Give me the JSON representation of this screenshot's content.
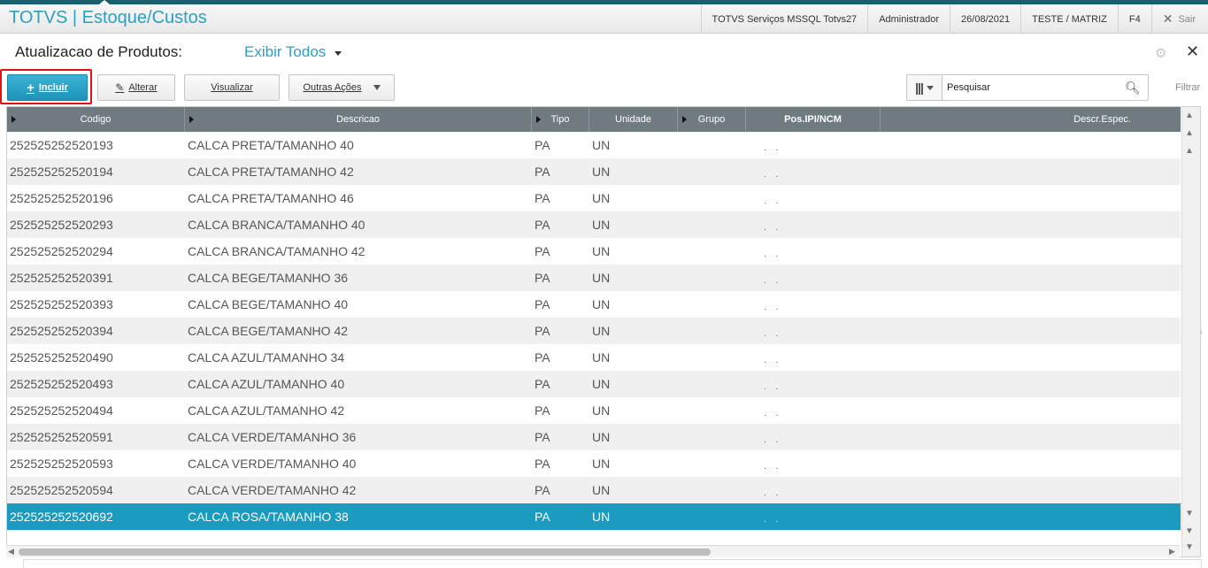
{
  "header": {
    "app_title": "TOTVS | Estoque/Custos",
    "server": "TOTVS Serviços MSSQL Totvs27",
    "user": "Administrador",
    "date": "26/08/2021",
    "company": "TESTE / MATRIZ",
    "hotkey": "F4",
    "exit_label": "Sair"
  },
  "page": {
    "title": "Atualizacao de Produtos:",
    "view_filter": "Exibir Todos"
  },
  "toolbar": {
    "incluir": "Incluir",
    "alterar": "Alterar",
    "visualizar": "Visualizar",
    "outras_acoes": "Outras Ações",
    "search_placeholder": "Pesquisar",
    "filtrar": "Filtrar"
  },
  "table": {
    "columns": [
      "Codigo",
      "Descricao",
      "Tipo",
      "Unidade",
      "Grupo",
      "Pos.IPI/NCM",
      "Descr.Espec."
    ],
    "rows": [
      {
        "codigo": "252525252520193",
        "descricao": "CALCA PRETA/TAMANHO 40",
        "tipo": "PA",
        "unidade": "UN",
        "ncm": ". ."
      },
      {
        "codigo": "252525252520194",
        "descricao": "CALCA PRETA/TAMANHO 42",
        "tipo": "PA",
        "unidade": "UN",
        "ncm": ". ."
      },
      {
        "codigo": "252525252520196",
        "descricao": "CALCA PRETA/TAMANHO 46",
        "tipo": "PA",
        "unidade": "UN",
        "ncm": ". ."
      },
      {
        "codigo": "252525252520293",
        "descricao": "CALCA BRANCA/TAMANHO 40",
        "tipo": "PA",
        "unidade": "UN",
        "ncm": ". ."
      },
      {
        "codigo": "252525252520294",
        "descricao": "CALCA BRANCA/TAMANHO 42",
        "tipo": "PA",
        "unidade": "UN",
        "ncm": ". ."
      },
      {
        "codigo": "252525252520391",
        "descricao": "CALCA BEGE/TAMANHO 36",
        "tipo": "PA",
        "unidade": "UN",
        "ncm": ". ."
      },
      {
        "codigo": "252525252520393",
        "descricao": "CALCA BEGE/TAMANHO 40",
        "tipo": "PA",
        "unidade": "UN",
        "ncm": ". ."
      },
      {
        "codigo": "252525252520394",
        "descricao": "CALCA BEGE/TAMANHO 42",
        "tipo": "PA",
        "unidade": "UN",
        "ncm": ". ."
      },
      {
        "codigo": "252525252520490",
        "descricao": "CALCA AZUL/TAMANHO 34",
        "tipo": "PA",
        "unidade": "UN",
        "ncm": ". ."
      },
      {
        "codigo": "252525252520493",
        "descricao": "CALCA AZUL/TAMANHO 40",
        "tipo": "PA",
        "unidade": "UN",
        "ncm": ". ."
      },
      {
        "codigo": "252525252520494",
        "descricao": "CALCA AZUL/TAMANHO 42",
        "tipo": "PA",
        "unidade": "UN",
        "ncm": ". ."
      },
      {
        "codigo": "252525252520591",
        "descricao": "CALCA VERDE/TAMANHO 36",
        "tipo": "PA",
        "unidade": "UN",
        "ncm": ". ."
      },
      {
        "codigo": "252525252520593",
        "descricao": "CALCA VERDE/TAMANHO 40",
        "tipo": "PA",
        "unidade": "UN",
        "ncm": ". ."
      },
      {
        "codigo": "252525252520594",
        "descricao": "CALCA VERDE/TAMANHO 42",
        "tipo": "PA",
        "unidade": "UN",
        "ncm": ". ."
      },
      {
        "codigo": "252525252520692",
        "descricao": "CALCA ROSA/TAMANHO 38",
        "tipo": "PA",
        "unidade": "UN",
        "ncm": ". ."
      }
    ],
    "selected_row": 14
  },
  "colors": {
    "accent": "#2aa0c6",
    "selected_row": "#1b9bc0",
    "header_bg": "#6f7b80",
    "highlight_box": "#e31212"
  },
  "icons": [
    "plus-icon",
    "pencil-icon",
    "columns-icon",
    "search-icon",
    "gear-icon",
    "close-icon"
  ]
}
